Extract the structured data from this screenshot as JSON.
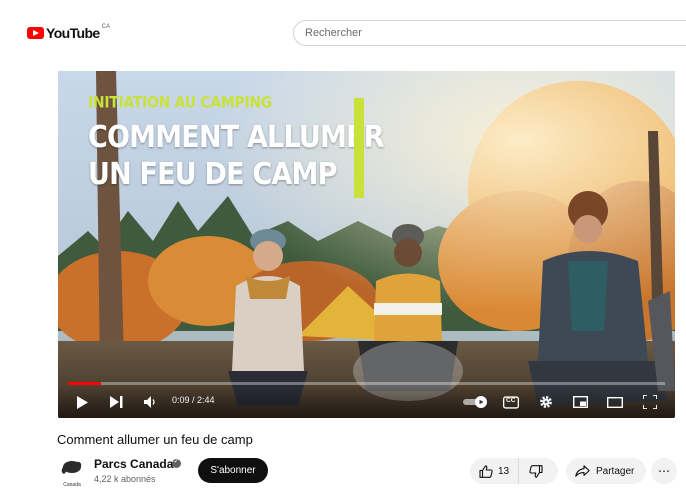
{
  "header": {
    "logo_text": "YouTube",
    "region_code": "CA",
    "search_placeholder": "Rechercher",
    "brand_color": "#ff0000"
  },
  "player": {
    "overlay_kicker": "INITIATION AU CAMPING",
    "overlay_title_line1": "COMMENT ALLUMER",
    "overlay_title_line2": "UN FEU DE CAMP",
    "accent_color": "#c9e23a",
    "time_display": "0:09 / 2:44",
    "progress_fraction": 0.055,
    "controls": [
      "play-icon",
      "next-icon",
      "volume-icon",
      "autoplay-toggle",
      "captions-icon",
      "settings-icon",
      "miniplayer-icon",
      "theater-icon",
      "fullscreen-icon"
    ],
    "captions_label": "CC"
  },
  "video": {
    "title": "Comment allumer un feu de camp"
  },
  "channel": {
    "name": "Parcs Canada",
    "subscribers": "4,22 k abonnés",
    "avatar_caption": "Canada",
    "subscribe_label": "S'abonner"
  },
  "actions": {
    "like_count": "13",
    "share_label": "Partager",
    "more_label": "⋯"
  }
}
